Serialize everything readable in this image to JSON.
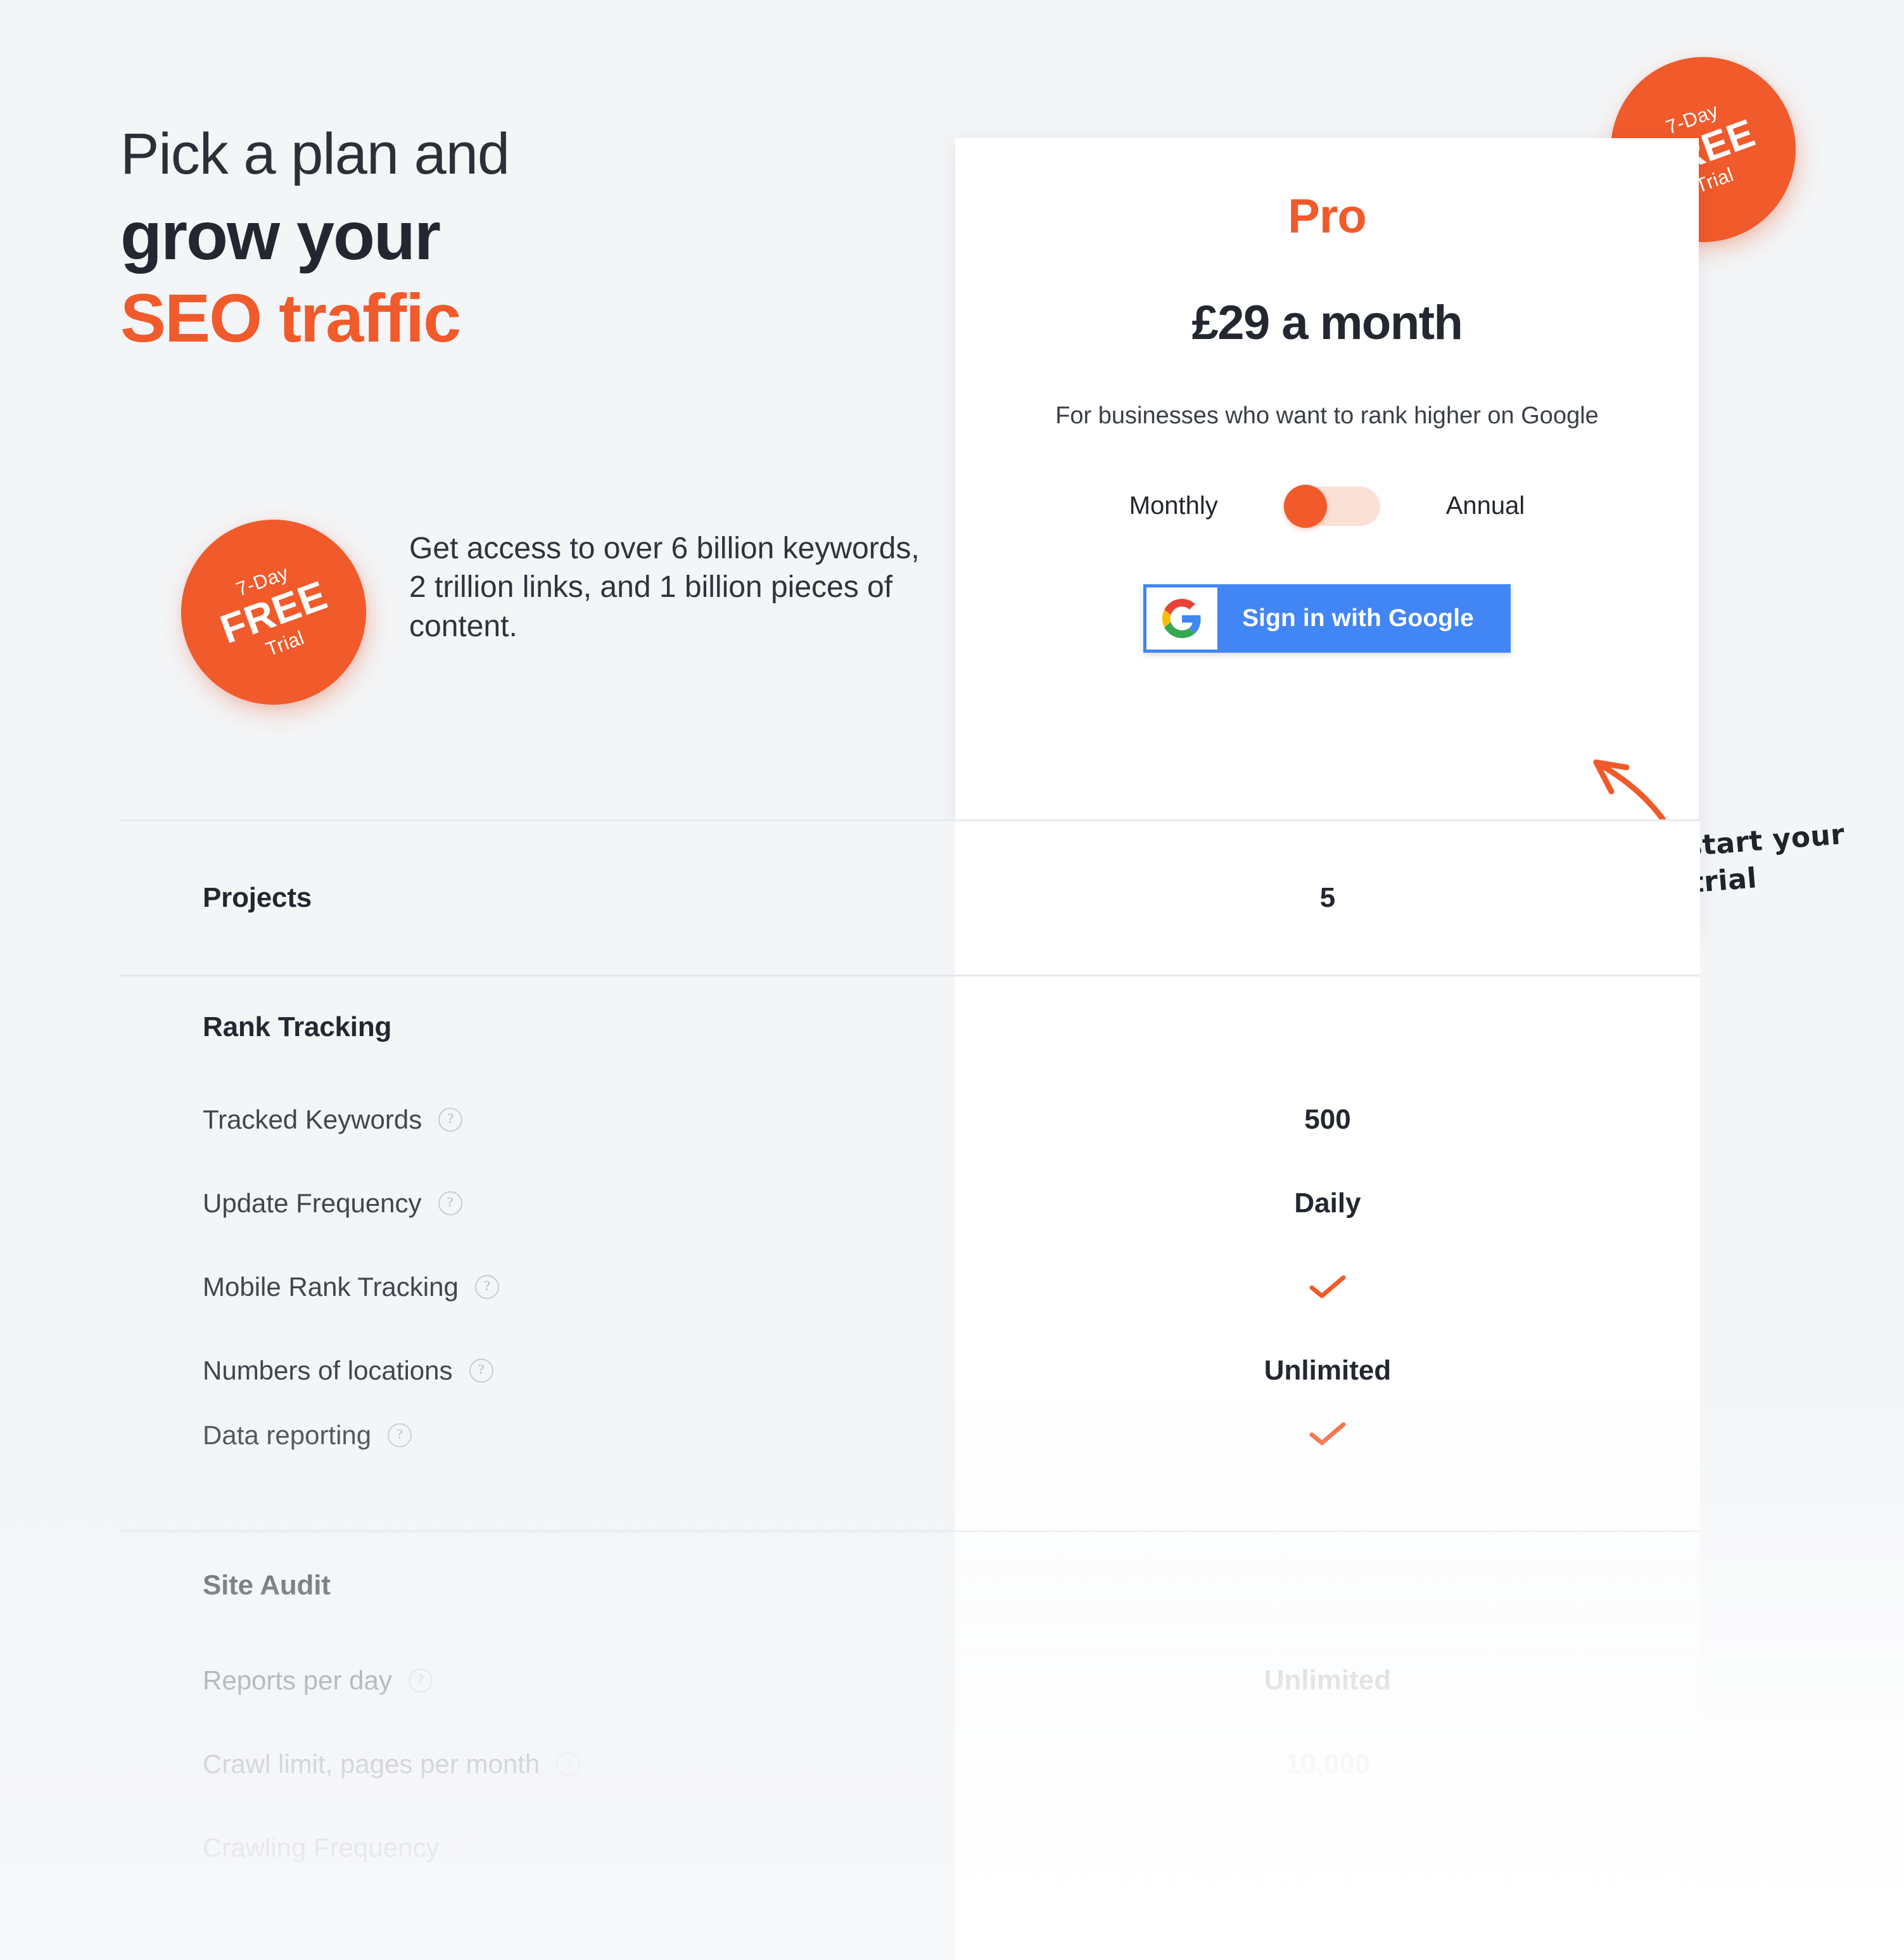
{
  "hero": {
    "line1": "Pick a plan and",
    "line2": "grow your",
    "line3": "SEO traffic",
    "subtext": "Get access to over 6 billion keywords,\n2 trillion links, and 1 billion pieces of content."
  },
  "badge": {
    "top": "7-Day",
    "mid": "FREE",
    "bottom": "Trial"
  },
  "plan": {
    "name": "Pro",
    "price": "£29 a month",
    "description": "For businesses who want to rank higher on Google",
    "billing_monthly": "Monthly",
    "billing_annual": "Annual",
    "billing_selected": "Monthly",
    "cta_label": "Sign in with Google"
  },
  "annotation": {
    "line1": "Sign in to start your",
    "line2": "free trial"
  },
  "table": {
    "groups": [
      {
        "title": "Projects",
        "title_value": "5",
        "rows": []
      },
      {
        "title": "Rank Tracking",
        "title_value": "",
        "rows": [
          {
            "label": "Tracked Keywords",
            "value": "500",
            "type": "text"
          },
          {
            "label": "Update Frequency",
            "value": "Daily",
            "type": "text"
          },
          {
            "label": "Mobile Rank Tracking",
            "value": "",
            "type": "check"
          },
          {
            "label": "Numbers of locations",
            "value": "Unlimited",
            "type": "text"
          },
          {
            "label": "Data reporting",
            "value": "",
            "type": "check"
          }
        ]
      },
      {
        "title": "Site Audit",
        "title_value": "",
        "rows": [
          {
            "label": "Reports per day",
            "value": "Unlimited",
            "type": "text"
          },
          {
            "label": "Crawl limit, pages per month",
            "value": "10,000",
            "type": "text"
          },
          {
            "label": "Crawling Frequency",
            "value": "Weekly",
            "type": "text"
          }
        ]
      }
    ],
    "help_icon": "?"
  },
  "colors": {
    "accent": "#f15a2b",
    "text_dark": "#232830",
    "google_blue": "#4285f4",
    "page_bg": "#f3f5f7",
    "row_border": "#e6e9ee"
  }
}
